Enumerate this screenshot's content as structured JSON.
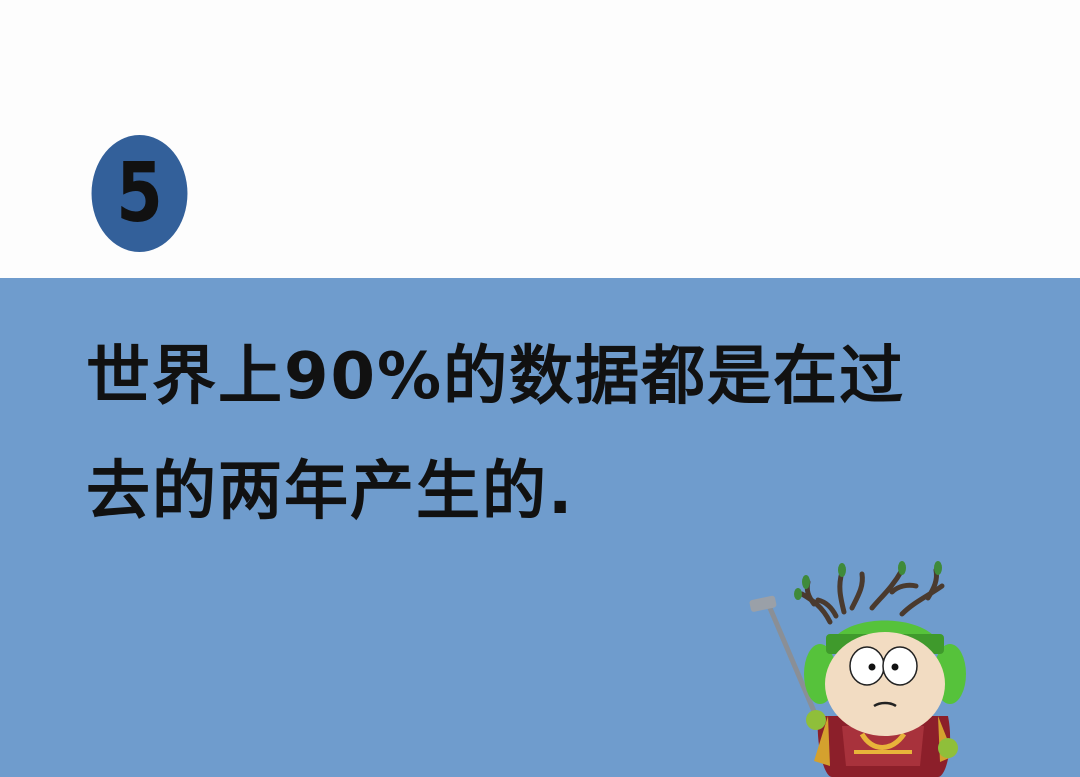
{
  "fact_number": "5",
  "fact_text": "世界上90%的数据都是在过\n去的两年产生的.",
  "colors": {
    "page_background": "#fdfdfd",
    "panel_background": "#6f9ccd",
    "badge_background": "#33609a",
    "text": "#111111"
  },
  "icons": {
    "character": "cartoon-character-with-golf-club-icon"
  }
}
